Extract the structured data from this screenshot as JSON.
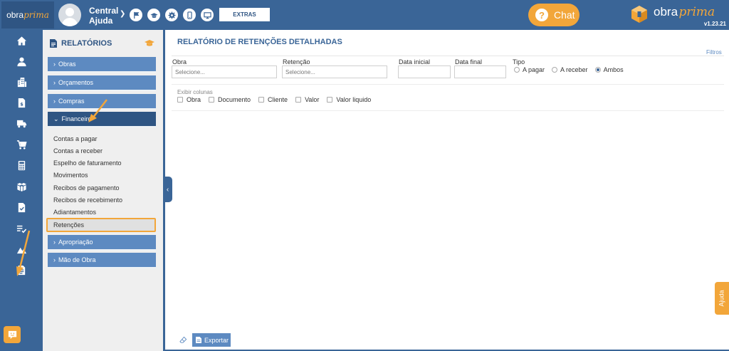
{
  "topbar": {
    "logo_main": "obra",
    "logo_accent": "prima",
    "user_line1": "Central",
    "user_line2": "Ajuda",
    "extras_label": "EXTRAS",
    "chat_label": "Chat",
    "brand_main": "obra",
    "brand_accent": "prima",
    "version": "v1.23.21",
    "icons": [
      "flag-icon",
      "graduation-cap-icon",
      "gear-icon",
      "mobile-icon",
      "monitor-icon"
    ]
  },
  "iconnav": {
    "items": [
      "home-icon",
      "user-icon",
      "building-icon",
      "invoice-icon",
      "truck-icon",
      "cart-icon",
      "calculator-icon",
      "boxes-icon",
      "document-check-icon",
      "checklist-icon",
      "terrain-icon",
      "report-document-icon"
    ]
  },
  "reports": {
    "title": "RELATÓRIOS",
    "groups": {
      "obras": "Obras",
      "orcamentos": "Orçamentos",
      "compras": "Compras",
      "financeiro": "Financeiro",
      "apropriacao": "Apropriação",
      "mao_de_obra": "Mão de Obra"
    },
    "financeiro_items": [
      "Contas a pagar",
      "Contas a receber",
      "Espelho de faturamento",
      "Movimentos",
      "Recibos de pagamento",
      "Recibos de recebimento",
      "Adiantamentos",
      "Retenções"
    ]
  },
  "main": {
    "title": "RELATÓRIO DE RETENÇÕES DETALHADAS",
    "filters_link": "Filtros",
    "obra_label": "Obra",
    "obra_placeholder": "Selecione...",
    "retencao_label": "Retenção",
    "retencao_placeholder": "Selecione...",
    "data_inicial_label": "Data inicial",
    "data_final_label": "Data final",
    "tipo_label": "Tipo",
    "tipo_options": [
      "A pagar",
      "A receber",
      "Ambos"
    ],
    "tipo_selected": "Ambos",
    "exibir_label": "Exibir colunas",
    "columns": [
      "Obra",
      "Documento",
      "Cliente",
      "Valor",
      "Valor liquido"
    ],
    "export_label": "Exportar",
    "help_tab_label": "Ajuda"
  },
  "colors": {
    "primary": "#3a6597",
    "primary_dark": "#2f5583",
    "menu_blue": "#5d8ac1",
    "accent_orange": "#f2a63a",
    "sidebar_bg": "#efefef"
  }
}
